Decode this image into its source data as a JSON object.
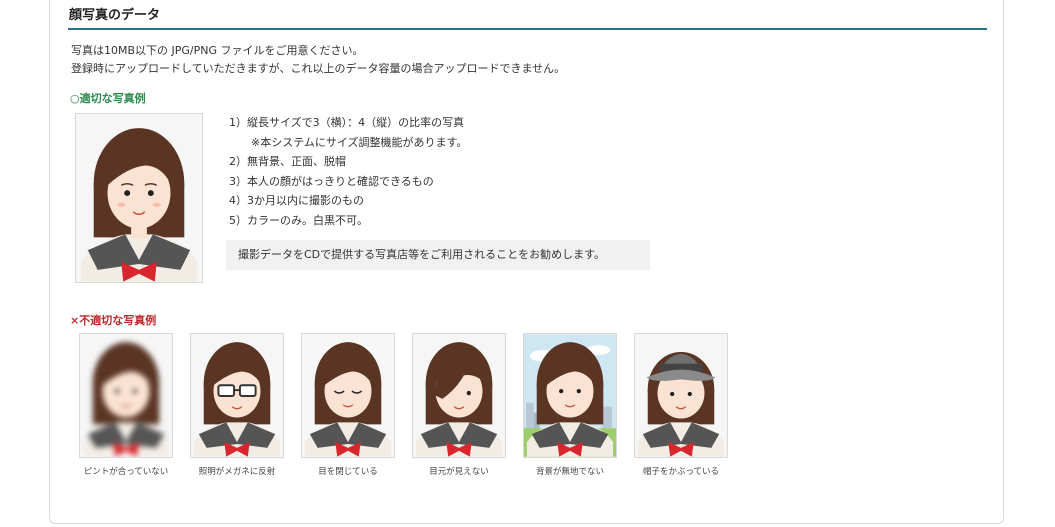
{
  "section": {
    "title": "顔写真のデータ"
  },
  "intro": {
    "line1": "写真は10MB以下の JPG/PNG ファイルをご用意ください。",
    "line2": "登録時にアップロードしていただきますが、これ以上のデータ容量の場合アップロードできません。"
  },
  "good": {
    "label": "○適切な写真例",
    "rules": [
      "1）縦長サイズで3（横）：4（縦）の比率の写真",
      "※本システムにサイズ調整機能があります。",
      "2）無背景、正面、脱帽",
      "3）本人の顔がはっきりと確認できるもの",
      "4）3か月以内に撮影のもの",
      "5）カラーのみ。白黒不可。"
    ],
    "advice": "撮影データをCDで提供する写真店等をご利用されることをお勧めします。"
  },
  "bad": {
    "label": "×不適切な写真例",
    "examples": [
      {
        "caption": "ピントが合っていない",
        "variant": "blur"
      },
      {
        "caption": "照明がメガネに反射",
        "variant": "glasses"
      },
      {
        "caption": "目を閉じている",
        "variant": "closed-eyes"
      },
      {
        "caption": "目元が見えない",
        "variant": "bangs"
      },
      {
        "caption": "背景が無地でない",
        "variant": "background"
      },
      {
        "caption": "帽子をかぶっている",
        "variant": "hat"
      }
    ]
  },
  "colors": {
    "hair": "#5a3524",
    "skin": "#fbe3d3",
    "collar": "#555555",
    "ribbon": "#d8262c",
    "accent_ok": "#2e8b4f",
    "accent_ng": "#c0282d",
    "rule": "#2e6f8a"
  }
}
